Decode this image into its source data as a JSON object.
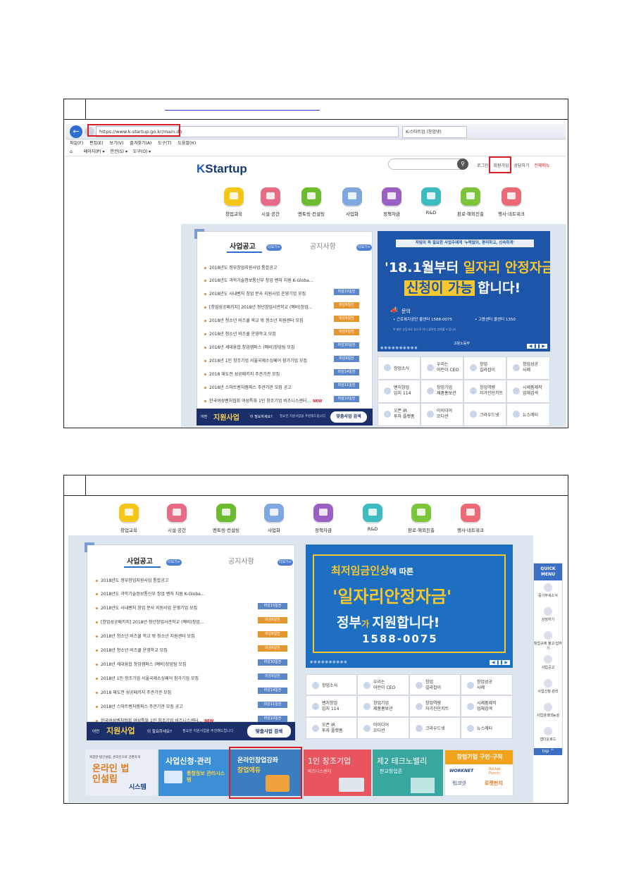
{
  "section1": {
    "browser": {
      "url": "https://www.k-startup.go.kr/main.do",
      "tab_title": "K-스타트업 (창업넷)",
      "menu": [
        "파일(F)",
        "편집(E)",
        "보기(V)",
        "즐겨찾기(A)",
        "도구(T)",
        "도움말(H)"
      ],
      "toolbar": [
        "페이지(P) ▾",
        "안전(S) ▾",
        "도구(O) ▾"
      ]
    },
    "site": {
      "logo_k": "K",
      "logo_rest": "Startup",
      "top_links": [
        "로그인",
        "회원가입",
        "상담하기",
        "전체메뉴"
      ]
    }
  },
  "categories": [
    {
      "label": "창업교육",
      "color": "#f5c518"
    },
    {
      "label": "시설·공간",
      "color": "#e86a86"
    },
    {
      "label": "멘토링·컨설팅",
      "color": "#6dbb2e"
    },
    {
      "label": "사업화",
      "color": "#7fa8e0"
    },
    {
      "label": "정책자금",
      "color": "#9c5fc4"
    },
    {
      "label": "R&D",
      "color": "#3cbcc0"
    },
    {
      "label": "판로·해외진출",
      "color": "#7cc53a"
    },
    {
      "label": "행사·네트워크",
      "color": "#ec6a78"
    }
  ],
  "notice": {
    "tab_active": "사업공고",
    "tab_inactive": "공지사항",
    "more": "더보기+",
    "items": [
      {
        "text": "2018년도 정부창업지원사업 통합공고",
        "badge": "",
        "badge_color": ""
      },
      {
        "text": "2018년도 과학기술정보통신부 창업 벤처 지원 K-Globa...",
        "badge": "",
        "badge_color": ""
      },
      {
        "text": "2018년도 사내벤처 창업 분사 지원사업 운영기업 모집",
        "badge": "마감15일전",
        "badge_color": "#5b86c9"
      },
      {
        "text": "[창업성공패키지] 2018년 청년창업사관학교 (예비)창업...",
        "badge": "마감6일전",
        "badge_color": "#e6962f"
      },
      {
        "text": "2018년 청소년 비즈쿨 학교 밖 청소년 지원센터 모집",
        "badge": "마감6일전",
        "badge_color": "#e6962f"
      },
      {
        "text": "2018년 청소년 비즈쿨 운영학교 모집",
        "badge": "마감6일전",
        "badge_color": "#e6962f"
      },
      {
        "text": "2018년 세대융합 창업캠퍼스 (예비)창업팀 모집",
        "badge": "마감30일전",
        "badge_color": "#5b86c9"
      },
      {
        "text": "2018년 1인 창조기업 서울국제소싱페어 참가기업 모집",
        "badge": "마감9일전",
        "badge_color": "#5b86c9"
      },
      {
        "text": "2018 재도전 성공패키지 주관기관 모집",
        "badge": "마감14일전",
        "badge_color": "#5b86c9"
      },
      {
        "text": "2018년 스마트벤처캠퍼스 주관기관 모집 공고",
        "badge": "마감11일전",
        "badge_color": "#5b86c9"
      },
      {
        "text": "한국여성벤처협회 여성특화 1인 창조기업 비즈니스센터...",
        "badge": "마감10일전",
        "badge_color": "#5b86c9"
      }
    ],
    "new_tag": "NEW",
    "strip_prefix": "어떤",
    "strip_highlight": "지원사업",
    "strip_mid": "이 필요하세요?",
    "strip_text": "필요한 지원사업을 추천해드립니다",
    "strip_btn": "맞춤사업 검색"
  },
  "banner1": {
    "top": "저임이 꼭 필요한 사업주에게 '누락없이, 편리하고, 신속하게'",
    "line1_a": "'18.1월부터 ",
    "line1_b": "일자리 안정자금",
    "line2_a": "신청이 가능",
    "line2_b": "합니다!",
    "contact_label": "문의",
    "contact1": "• 근로복지공단 콜센터 1588-0075",
    "contact2": "• 고용센터 콜센터 1350",
    "note": "※ 제반 상담자료 등으로 어디 불편한 양해를 드립니다",
    "agency": "고용노동부"
  },
  "banner2": {
    "line1_a": "최저임금인상",
    "line1_b": "에 따른",
    "line2": "'일자리안정자금'",
    "line3_a": "정부",
    "line3_b": "가 ",
    "line3_c": "지원합니다!",
    "phone": "1588-0075"
  },
  "tiles": [
    {
      "label": "창업소식",
      "label2": ""
    },
    {
      "label": "우리는",
      "label2": "어린이 CEO"
    },
    {
      "label": "창업",
      "label2": "길라잡이"
    },
    {
      "label": "창업성공",
      "label2": "사례"
    },
    {
      "label": "벤처창업",
      "label2": "입지 114"
    },
    {
      "label": "창업기업",
      "label2": "제품홍보관"
    },
    {
      "label": "창업역량",
      "label2": "자가진단키트"
    },
    {
      "label": "시제품제작",
      "label2": "업체검색"
    },
    {
      "label": "오픈 IR",
      "label2": "투자 플랫폼"
    },
    {
      "label": "아이디어",
      "label2": "오디션"
    },
    {
      "label": "크라우드넷",
      "label2": ""
    },
    {
      "label": "뉴스레터",
      "label2": ""
    }
  ],
  "quick_menu": {
    "title": "QUICK MENU",
    "items": [
      "중기부세소식",
      "상담하기",
      "창업규제 물고·답하기",
      "사업공고",
      "사업신청·관리",
      "사업검색대능설",
      "앱다운로드"
    ],
    "top": "top ^"
  },
  "promos": [
    {
      "small": "복잡한 법인설립, 온라인으로 간편하게",
      "big": "온라인 법인설립",
      "suffix": "시스템",
      "bg": "#e9eef6",
      "fg": "#1e3e88"
    },
    {
      "small": "사업신청·관리",
      "big": "통합정보 관리시스템",
      "suffix": "",
      "bg": "#3b8fd6",
      "fg": "#ffffff"
    },
    {
      "small": "온라인창업강좌",
      "big": "창업에듀",
      "suffix": "",
      "bg": "#3a7dc0",
      "fg": "#ffffff"
    },
    {
      "small": "1인 창조기업",
      "big": "비즈니스센터",
      "suffix": "",
      "bg": "#e9555f",
      "fg": "#ffffff"
    },
    {
      "small": "제2 테크노밸리",
      "big": "판교창업존",
      "suffix": "",
      "bg": "#3aa6a0",
      "fg": "#ffffff"
    },
    {
      "small": "창업기업 구인·구직",
      "big": "워크넷",
      "suffix": "로켓펀치",
      "bg": "#ffffff",
      "fg": "#e07a1c"
    }
  ],
  "promo_extra": {
    "worknet_logo": "WORKNET",
    "rocket_logo": "Rocket Punch"
  },
  "search_icon": "search-icon"
}
